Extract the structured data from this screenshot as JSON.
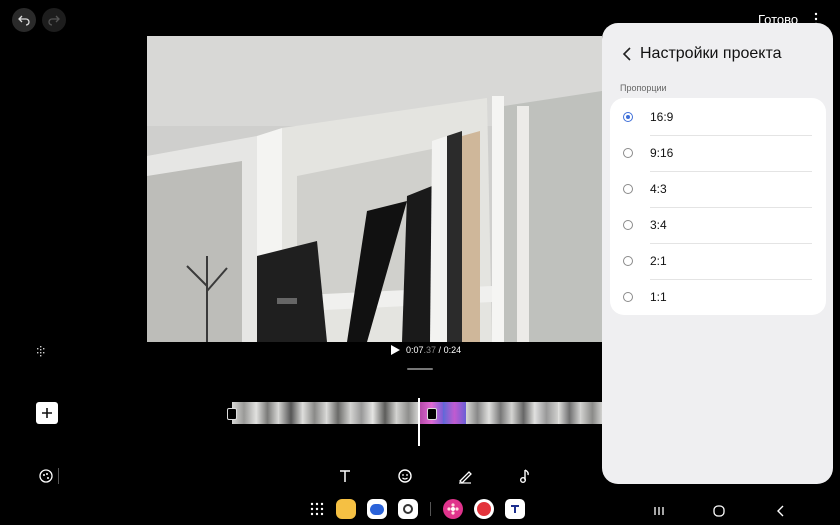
{
  "header": {
    "done_label": "Готово"
  },
  "player": {
    "time_current": "0:07",
    "time_frac": ".37",
    "time_sep": " / ",
    "time_total": "0:24"
  },
  "panel": {
    "title": "Настройки проекта",
    "section_label": "Пропорции",
    "options": [
      {
        "label": "16:9",
        "checked": true
      },
      {
        "label": "9:16",
        "checked": false
      },
      {
        "label": "4:3",
        "checked": false
      },
      {
        "label": "3:4",
        "checked": false
      },
      {
        "label": "2:1",
        "checked": false
      },
      {
        "label": "1:1",
        "checked": false
      }
    ]
  },
  "colors": {
    "accent": "#3f6fd8",
    "panel_bg": "#efeff1"
  },
  "icons": [
    "undo-icon",
    "redo-icon",
    "more-icon",
    "play-icon",
    "add-icon",
    "text-icon",
    "sticker-icon",
    "draw-icon",
    "music-icon",
    "apps-icon",
    "back-icon",
    "home-icon",
    "recents-icon"
  ]
}
